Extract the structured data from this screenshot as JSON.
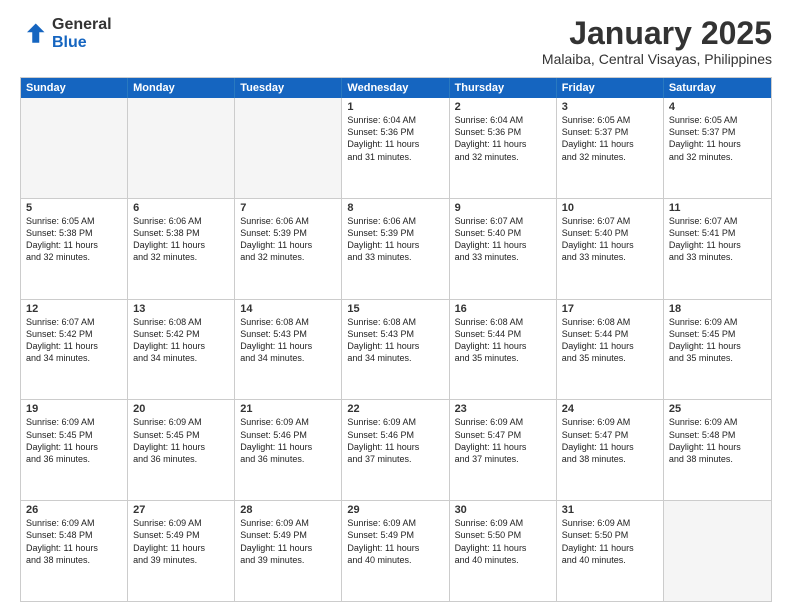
{
  "header": {
    "logo_general": "General",
    "logo_blue": "Blue",
    "main_title": "January 2025",
    "subtitle": "Malaiba, Central Visayas, Philippines"
  },
  "calendar": {
    "days_of_week": [
      "Sunday",
      "Monday",
      "Tuesday",
      "Wednesday",
      "Thursday",
      "Friday",
      "Saturday"
    ],
    "weeks": [
      [
        {
          "day": "",
          "text": "",
          "empty": true
        },
        {
          "day": "",
          "text": "",
          "empty": true
        },
        {
          "day": "",
          "text": "",
          "empty": true
        },
        {
          "day": "1",
          "text": "Sunrise: 6:04 AM\nSunset: 5:36 PM\nDaylight: 11 hours\nand 31 minutes.",
          "empty": false
        },
        {
          "day": "2",
          "text": "Sunrise: 6:04 AM\nSunset: 5:36 PM\nDaylight: 11 hours\nand 32 minutes.",
          "empty": false
        },
        {
          "day": "3",
          "text": "Sunrise: 6:05 AM\nSunset: 5:37 PM\nDaylight: 11 hours\nand 32 minutes.",
          "empty": false
        },
        {
          "day": "4",
          "text": "Sunrise: 6:05 AM\nSunset: 5:37 PM\nDaylight: 11 hours\nand 32 minutes.",
          "empty": false
        }
      ],
      [
        {
          "day": "5",
          "text": "Sunrise: 6:05 AM\nSunset: 5:38 PM\nDaylight: 11 hours\nand 32 minutes.",
          "empty": false
        },
        {
          "day": "6",
          "text": "Sunrise: 6:06 AM\nSunset: 5:38 PM\nDaylight: 11 hours\nand 32 minutes.",
          "empty": false
        },
        {
          "day": "7",
          "text": "Sunrise: 6:06 AM\nSunset: 5:39 PM\nDaylight: 11 hours\nand 32 minutes.",
          "empty": false
        },
        {
          "day": "8",
          "text": "Sunrise: 6:06 AM\nSunset: 5:39 PM\nDaylight: 11 hours\nand 33 minutes.",
          "empty": false
        },
        {
          "day": "9",
          "text": "Sunrise: 6:07 AM\nSunset: 5:40 PM\nDaylight: 11 hours\nand 33 minutes.",
          "empty": false
        },
        {
          "day": "10",
          "text": "Sunrise: 6:07 AM\nSunset: 5:40 PM\nDaylight: 11 hours\nand 33 minutes.",
          "empty": false
        },
        {
          "day": "11",
          "text": "Sunrise: 6:07 AM\nSunset: 5:41 PM\nDaylight: 11 hours\nand 33 minutes.",
          "empty": false
        }
      ],
      [
        {
          "day": "12",
          "text": "Sunrise: 6:07 AM\nSunset: 5:42 PM\nDaylight: 11 hours\nand 34 minutes.",
          "empty": false
        },
        {
          "day": "13",
          "text": "Sunrise: 6:08 AM\nSunset: 5:42 PM\nDaylight: 11 hours\nand 34 minutes.",
          "empty": false
        },
        {
          "day": "14",
          "text": "Sunrise: 6:08 AM\nSunset: 5:43 PM\nDaylight: 11 hours\nand 34 minutes.",
          "empty": false
        },
        {
          "day": "15",
          "text": "Sunrise: 6:08 AM\nSunset: 5:43 PM\nDaylight: 11 hours\nand 34 minutes.",
          "empty": false
        },
        {
          "day": "16",
          "text": "Sunrise: 6:08 AM\nSunset: 5:44 PM\nDaylight: 11 hours\nand 35 minutes.",
          "empty": false
        },
        {
          "day": "17",
          "text": "Sunrise: 6:08 AM\nSunset: 5:44 PM\nDaylight: 11 hours\nand 35 minutes.",
          "empty": false
        },
        {
          "day": "18",
          "text": "Sunrise: 6:09 AM\nSunset: 5:45 PM\nDaylight: 11 hours\nand 35 minutes.",
          "empty": false
        }
      ],
      [
        {
          "day": "19",
          "text": "Sunrise: 6:09 AM\nSunset: 5:45 PM\nDaylight: 11 hours\nand 36 minutes.",
          "empty": false
        },
        {
          "day": "20",
          "text": "Sunrise: 6:09 AM\nSunset: 5:45 PM\nDaylight: 11 hours\nand 36 minutes.",
          "empty": false
        },
        {
          "day": "21",
          "text": "Sunrise: 6:09 AM\nSunset: 5:46 PM\nDaylight: 11 hours\nand 36 minutes.",
          "empty": false
        },
        {
          "day": "22",
          "text": "Sunrise: 6:09 AM\nSunset: 5:46 PM\nDaylight: 11 hours\nand 37 minutes.",
          "empty": false
        },
        {
          "day": "23",
          "text": "Sunrise: 6:09 AM\nSunset: 5:47 PM\nDaylight: 11 hours\nand 37 minutes.",
          "empty": false
        },
        {
          "day": "24",
          "text": "Sunrise: 6:09 AM\nSunset: 5:47 PM\nDaylight: 11 hours\nand 38 minutes.",
          "empty": false
        },
        {
          "day": "25",
          "text": "Sunrise: 6:09 AM\nSunset: 5:48 PM\nDaylight: 11 hours\nand 38 minutes.",
          "empty": false
        }
      ],
      [
        {
          "day": "26",
          "text": "Sunrise: 6:09 AM\nSunset: 5:48 PM\nDaylight: 11 hours\nand 38 minutes.",
          "empty": false
        },
        {
          "day": "27",
          "text": "Sunrise: 6:09 AM\nSunset: 5:49 PM\nDaylight: 11 hours\nand 39 minutes.",
          "empty": false
        },
        {
          "day": "28",
          "text": "Sunrise: 6:09 AM\nSunset: 5:49 PM\nDaylight: 11 hours\nand 39 minutes.",
          "empty": false
        },
        {
          "day": "29",
          "text": "Sunrise: 6:09 AM\nSunset: 5:49 PM\nDaylight: 11 hours\nand 40 minutes.",
          "empty": false
        },
        {
          "day": "30",
          "text": "Sunrise: 6:09 AM\nSunset: 5:50 PM\nDaylight: 11 hours\nand 40 minutes.",
          "empty": false
        },
        {
          "day": "31",
          "text": "Sunrise: 6:09 AM\nSunset: 5:50 PM\nDaylight: 11 hours\nand 40 minutes.",
          "empty": false
        },
        {
          "day": "",
          "text": "",
          "empty": true
        }
      ]
    ]
  }
}
